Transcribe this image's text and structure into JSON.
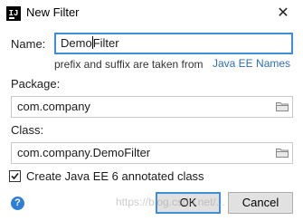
{
  "window": {
    "app_icon_text": "IJ",
    "title": "New Filter",
    "close_glyph": "✕"
  },
  "name": {
    "label": "Name:",
    "value_before_caret": "Demo",
    "value_after_caret": "Filter",
    "hint": "prefix and suffix are taken from",
    "hint_link": "Java EE Names"
  },
  "package": {
    "label": "Package:",
    "value": "com.company",
    "browse_icon": "folder-icon"
  },
  "class": {
    "label": "Class:",
    "value": "com.company.DemoFilter",
    "browse_icon": "folder-icon"
  },
  "checkbox": {
    "label": "Create Java EE 6 annotated class",
    "checked": true,
    "glyph": "✓"
  },
  "footer": {
    "help_glyph": "?",
    "ok_label": "OK",
    "cancel_label": "Cancel",
    "watermark": "https://blog.csdn.net/..."
  },
  "colors": {
    "focus_border": "#3d8fd6",
    "link": "#2f6fb8",
    "help_icon": "#2f7fd8"
  }
}
